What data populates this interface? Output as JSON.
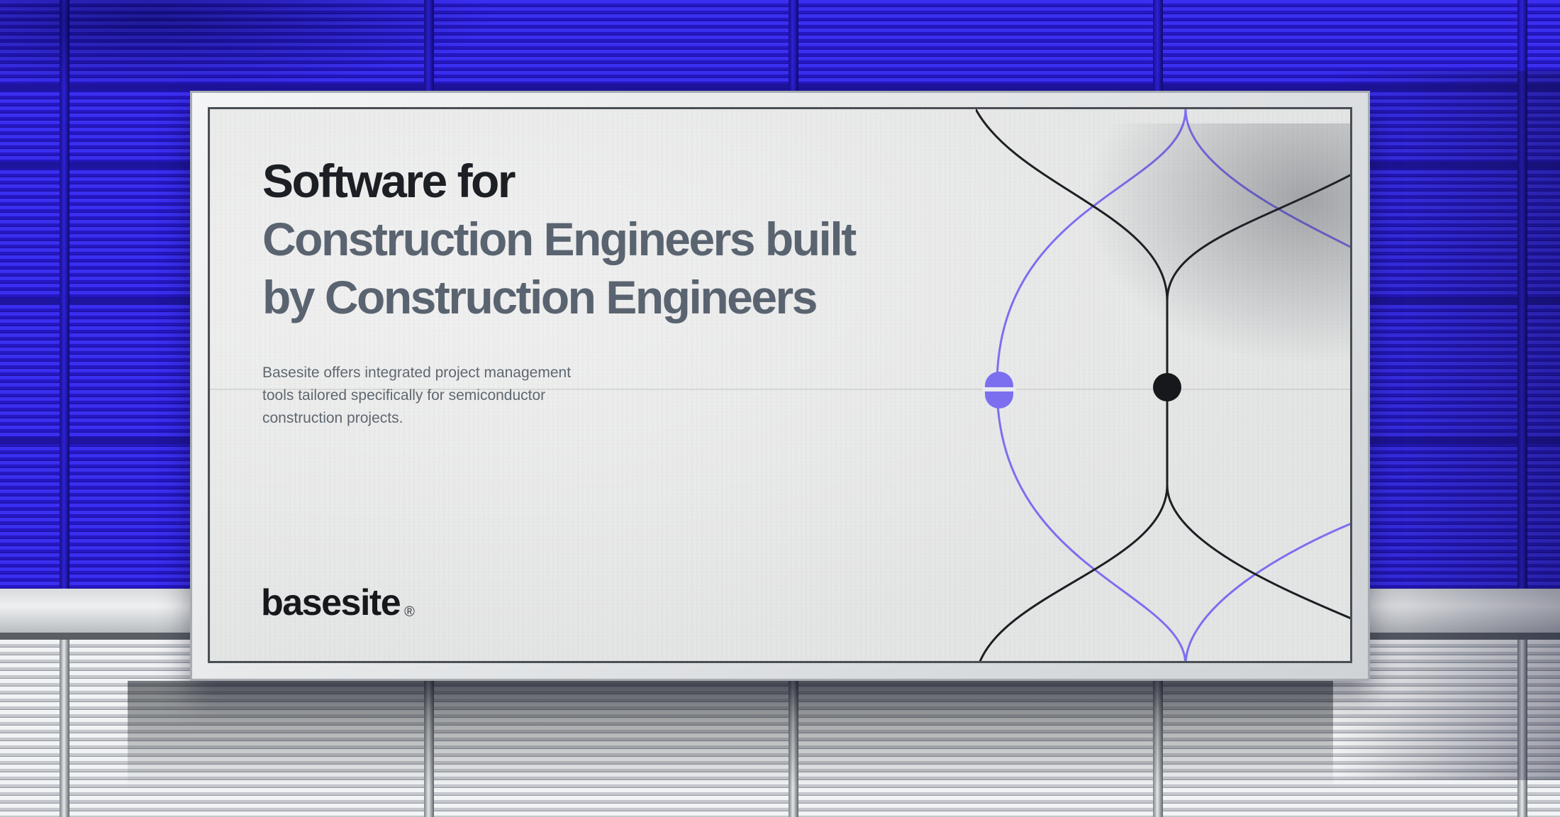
{
  "billboard": {
    "headline": {
      "line1": "Software for",
      "line2": "Construction Engineers built",
      "line3": "by Construction Engineers"
    },
    "description": {
      "line1": "Basesite offers integrated project management",
      "line2": "tools tailored specifically for semiconductor",
      "line3": "construction projects."
    },
    "logo": {
      "text": "basesite",
      "mark": "®"
    }
  },
  "colors": {
    "wall": "#2a1fd0",
    "accent_line": "#7b6ff0",
    "dark_line": "#1c1f23",
    "headline_dark": "#1c1f23",
    "headline_muted": "#5a6470"
  }
}
